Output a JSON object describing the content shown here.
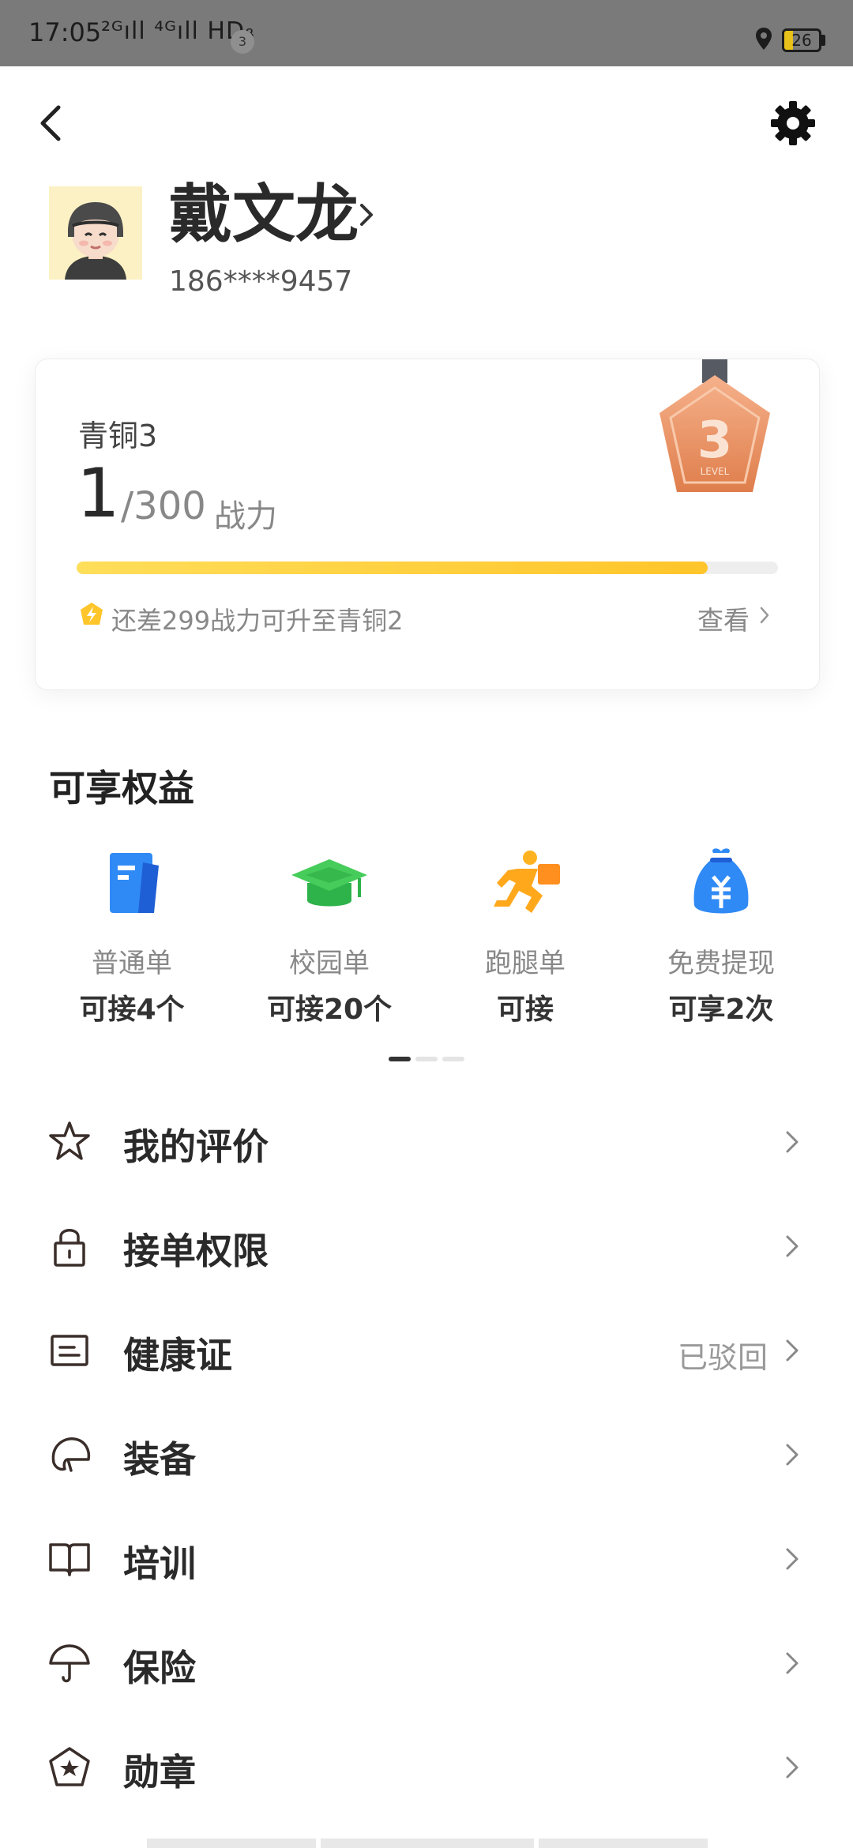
{
  "status_bar": {
    "time": "17:05",
    "network": "²ᴳıll ⁴ᴳıll HDᵦ",
    "notification_count": "3",
    "battery": "26",
    "battery_level": 0.26
  },
  "profile": {
    "name": "戴文龙",
    "phone": "186****9457"
  },
  "level_card": {
    "level_name": "青铜3",
    "points_current": "1",
    "points_total": "/300",
    "points_unit": "战力",
    "progress_fraction": 0.9,
    "tip": "还差299战力可升至青铜2",
    "view_label": "查看",
    "medal_number": "3",
    "medal_caption": "LEVEL",
    "accent_color": "#ffc52a"
  },
  "benefits": {
    "title": "可享权益",
    "items": [
      {
        "icon": "document-icon",
        "label": "普通单",
        "value": "可接4个"
      },
      {
        "icon": "graduation-cap-icon",
        "label": "校园单",
        "value": "可接20个"
      },
      {
        "icon": "runner-icon",
        "label": "跑腿单",
        "value": "可接"
      },
      {
        "icon": "money-bag-icon",
        "label": "免费提现",
        "value": "可享2次"
      }
    ],
    "page_index": 1,
    "page_count": 3
  },
  "menu": [
    {
      "icon": "star-icon",
      "label": "我的评价",
      "status": ""
    },
    {
      "icon": "lock-icon",
      "label": "接单权限",
      "status": ""
    },
    {
      "icon": "id-card-icon",
      "label": "健康证",
      "status": "已驳回"
    },
    {
      "icon": "helmet-icon",
      "label": "装备",
      "status": ""
    },
    {
      "icon": "book-icon",
      "label": "培训",
      "status": ""
    },
    {
      "icon": "umbrella-icon",
      "label": "保险",
      "status": ""
    },
    {
      "icon": "badge-icon",
      "label": "勋章",
      "status": ""
    }
  ]
}
